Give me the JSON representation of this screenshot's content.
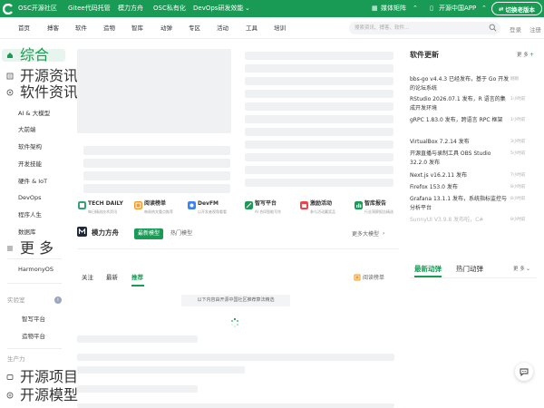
{
  "topbar": {
    "items": [
      "OSC开源社区",
      "Gitee代码托管",
      "模力方舟",
      "OSC私有化",
      "DevOps研发效能"
    ],
    "media": "媒体矩阵",
    "app": "开源中国APP",
    "switch": "切换老版本"
  },
  "nav": {
    "items": [
      "首页",
      "搏客",
      "软件",
      "造物",
      "智库",
      "动弹",
      "专区",
      "活动",
      "工具",
      "培训"
    ],
    "search_placeholder": "搜索资讯、搏客、软件...",
    "login": "登录",
    "register": "注册"
  },
  "leftnav": {
    "items": [
      {
        "label": "综合",
        "icon": "home-icon"
      },
      {
        "label": "开源资讯",
        "icon": "news-icon"
      },
      {
        "label": "软件资讯",
        "icon": "software-news-icon"
      }
    ],
    "sub": [
      "AI & 大模型",
      "大前端",
      "软件架构",
      "开发技能",
      "硬件 & IoT",
      "DevOps",
      "程序人生",
      "数据库"
    ],
    "more": "更 多",
    "harmony": "HarmonyOS",
    "lab": "实验室",
    "lab_items": [
      "智写平台",
      "造物平台"
    ],
    "prod": "生产力",
    "prod_items": [
      "开源项目",
      "开源模型"
    ]
  },
  "cats": [
    {
      "title": "TECH DAILY",
      "sub": "每日精选技术资讯",
      "color": "#2fa672"
    },
    {
      "title": "阅读榜单",
      "sub": "每周热文重点推荐",
      "color": "#f59a23"
    },
    {
      "title": "DevFM",
      "sub": "以开发者视角看看",
      "color": "#3b82f6"
    },
    {
      "title": "智写平台",
      "sub": "AI 合同智能写作",
      "color": "#1a9b55"
    },
    {
      "title": "激励活动",
      "sub": "参与活动赢奖品",
      "color": "#ef4444"
    },
    {
      "title": "智库报告",
      "sub": "行业洞察报告精选",
      "color": "#1a9b55"
    }
  ],
  "section": {
    "title": "模力方舟",
    "tab_on": "最新模型",
    "tab_off": "热门模型",
    "more": "更多大模型"
  },
  "feed": {
    "tabs": [
      "关注",
      "最新",
      "推荐"
    ],
    "rank": "阅读榜单",
    "notice": "以下内容由开源中国社区推荐算法精选"
  },
  "right": {
    "title": "软件更新",
    "more": "更 多",
    "items": [
      {
        "text": "bbs-go v4.4.3 已经发布，基于 Go 开发的论坛系统",
        "time": "刚刚"
      },
      {
        "text": "RStudio 2026.07.1 发布，R 语言的集成开发环境",
        "time": "1小时前"
      },
      {
        "text": "gRPC 1.83.0 发布，跨语言 RPC 框架",
        "time": "1小时前"
      },
      {
        "text": "VirtualBox 7.2.14 发布",
        "time": "3小时前"
      },
      {
        "text": "开源直播与录制工具 OBS Studio 32.2.0 发布",
        "time": "5小时前"
      },
      {
        "text": "Next.js v16.2.11 发布",
        "time": "7小时前"
      },
      {
        "text": "Firefox 153.0 发布",
        "time": "8小时前"
      },
      {
        "text": "Grafana 13.1.1 发布，系统指标监控与分析平台",
        "time": "8小时前"
      },
      {
        "text": "SunnyUI V3.9.8 发布啦，C#",
        "time": "8小时前"
      }
    ],
    "tabs": [
      "最新动弹",
      "热门动弹"
    ],
    "tabs_more": "更 多"
  },
  "colors": {
    "brand": "#1a9b55"
  }
}
